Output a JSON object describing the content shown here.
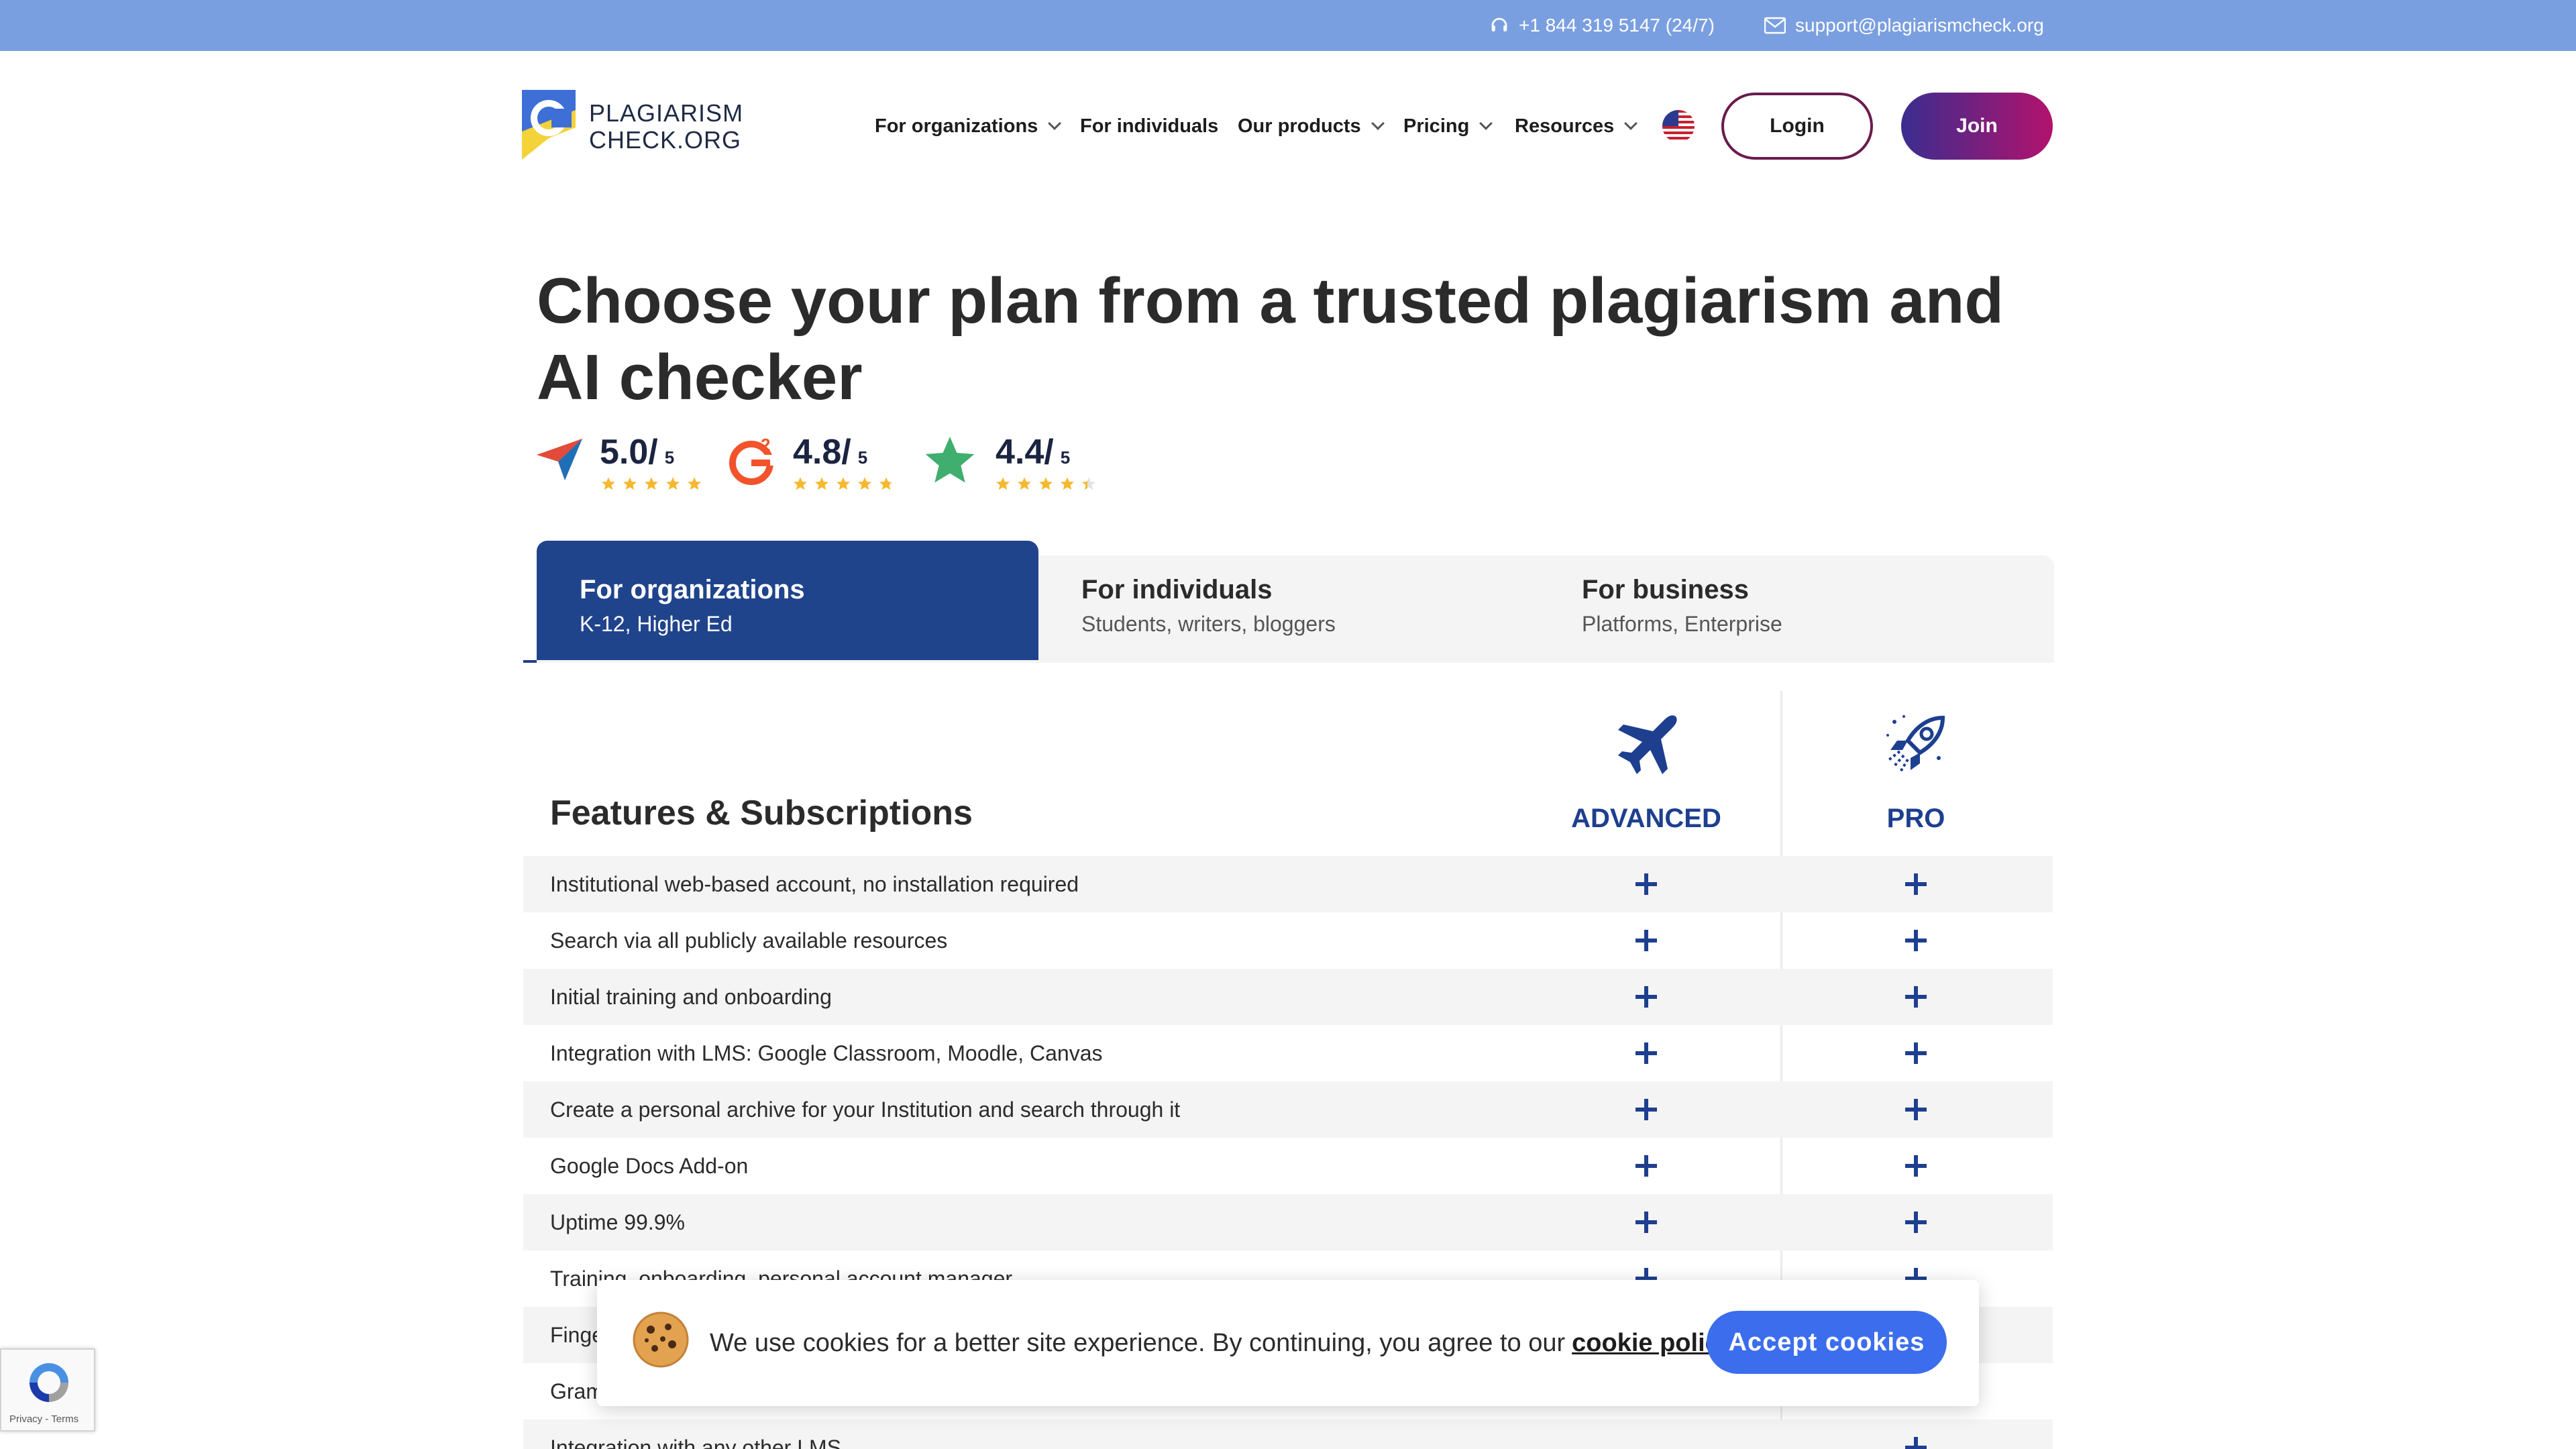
{
  "topbar": {
    "phone": "+1 844 319 5147 (24/7)",
    "email": "support@plagiarismcheck.org",
    "phone_icon": "headset-icon",
    "email_icon": "envelope-icon"
  },
  "header": {
    "logo_line1": "PLAGIARISM",
    "logo_line2": "CHECK.ORG",
    "nav": [
      {
        "label": "For organizations",
        "has_dropdown": true
      },
      {
        "label": "For individuals",
        "has_dropdown": false
      },
      {
        "label": "Our products",
        "has_dropdown": true
      },
      {
        "label": "Pricing",
        "has_dropdown": true
      },
      {
        "label": "Resources",
        "has_dropdown": true
      }
    ],
    "language_icon": "us-flag-icon",
    "login": "Login",
    "join": "Join"
  },
  "hero": {
    "title": "Choose your plan from a trusted plagiarism and AI checker",
    "ratings": [
      {
        "score": "5.0/",
        "max": "5",
        "stars": 5,
        "icon": "paper-plane-review-icon"
      },
      {
        "score": "4.8/",
        "max": "5",
        "stars": 4.8,
        "icon": "g2-logo-icon"
      },
      {
        "score": "4.4/",
        "max": "5",
        "stars": 4.4,
        "icon": "trustpilot-star-icon"
      }
    ]
  },
  "tabs": [
    {
      "title": "For organizations",
      "subtitle": "K-12, Higher Ed",
      "active": true
    },
    {
      "title": "For individuals",
      "subtitle": "Students, writers, bloggers",
      "active": false
    },
    {
      "title": "For business",
      "subtitle": "Platforms, Enterprise",
      "active": false
    }
  ],
  "table": {
    "heading": "Features & Subscriptions",
    "plans": [
      {
        "name": "ADVANCED",
        "icon": "airplane-icon"
      },
      {
        "name": "PRO",
        "icon": "rocket-icon"
      }
    ],
    "rows": [
      {
        "label": "Institutional web-based account, no installation required",
        "advanced": true,
        "pro": true
      },
      {
        "label": "Search via all publicly available resources",
        "advanced": true,
        "pro": true
      },
      {
        "label": "Initial training and onboarding",
        "advanced": true,
        "pro": true
      },
      {
        "label": "Integration with LMS: Google Classroom, Moodle, Canvas",
        "advanced": true,
        "pro": true
      },
      {
        "label": "Create a personal archive for your Institution and search through it",
        "advanced": true,
        "pro": true
      },
      {
        "label": "Google Docs Add-on",
        "advanced": true,
        "pro": true
      },
      {
        "label": "Uptime 99.9%",
        "advanced": true,
        "pro": true
      },
      {
        "label": "Training, onboarding, personal account manager",
        "advanced": true,
        "pro": true
      },
      {
        "label": "Finge",
        "advanced": true,
        "pro": true
      },
      {
        "label": "Gram",
        "advanced": true,
        "pro": true
      },
      {
        "label": "Integration with any other LMS",
        "advanced": false,
        "pro": true
      }
    ]
  },
  "cookie": {
    "text": "We use cookies for a better site experience. By continuing, you agree to our",
    "link": "cookie policy",
    "period": ".",
    "button": "Accept cookies",
    "icon": "cookie-icon"
  },
  "recaptcha": {
    "links": "Privacy - Terms"
  }
}
